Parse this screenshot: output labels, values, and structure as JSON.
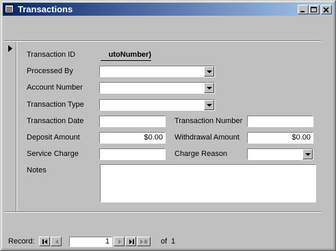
{
  "window": {
    "title": "Transactions"
  },
  "form": {
    "transaction_id": {
      "label": "Transaction ID",
      "value": "utoNumber)"
    },
    "processed_by": {
      "label": "Processed By",
      "value": ""
    },
    "account_number": {
      "label": "Account Number",
      "value": ""
    },
    "transaction_type": {
      "label": "Transaction Type",
      "value": ""
    },
    "transaction_date": {
      "label": "Transaction Date",
      "value": ""
    },
    "transaction_number": {
      "label": "Transaction Number",
      "value": ""
    },
    "deposit_amount": {
      "label": "Deposit Amount",
      "value": "$0.00"
    },
    "withdrawal_amount": {
      "label": "Withdrawal Amount",
      "value": "$0.00"
    },
    "service_charge": {
      "label": "Service Charge",
      "value": ""
    },
    "charge_reason": {
      "label": "Charge Reason",
      "value": ""
    },
    "notes": {
      "label": "Notes",
      "value": ""
    }
  },
  "navigation": {
    "record_label": "Record:",
    "current": "1",
    "of_label": "of",
    "total": "1"
  },
  "icons": [
    "form-icon",
    "minimize-icon",
    "maximize-icon",
    "close-icon",
    "record-selector-arrow-icon",
    "first-record-icon",
    "previous-record-icon",
    "next-record-icon",
    "last-record-icon",
    "new-record-icon"
  ]
}
